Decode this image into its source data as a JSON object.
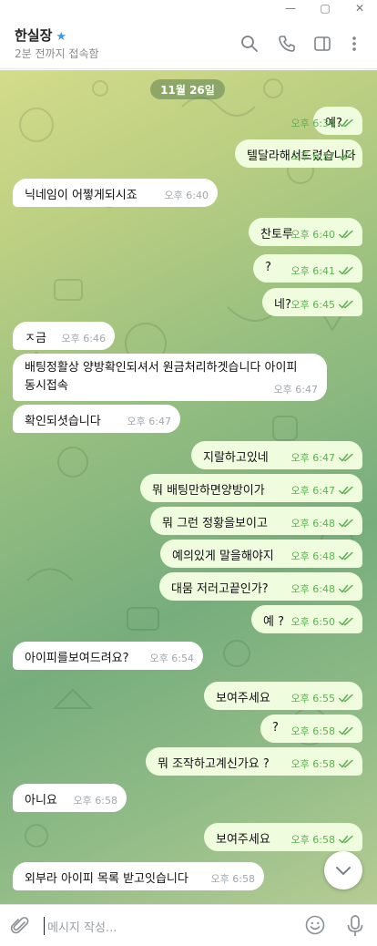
{
  "window": {
    "controls": [
      "—",
      "▢",
      "✕"
    ]
  },
  "header": {
    "name": "한실장",
    "star": "★",
    "status": "2분 전까지 접속함",
    "icons": [
      "search-icon",
      "phone-icon",
      "sidebar-toggle-icon",
      "more-vertical-icon"
    ]
  },
  "chat": {
    "date": "11월 26일",
    "messages": [
      {
        "dir": "out",
        "text": "예?",
        "time": "오후 6:34"
      },
      {
        "dir": "out",
        "text": "텔달라해서드렸습니다",
        "time": "오후 6:37"
      },
      {
        "dir": "in",
        "text": "닉네임이 어쩧게되시죠",
        "time": "오후 6:40"
      },
      {
        "dir": "out",
        "text": "찬토루",
        "time": "오후 6:40"
      },
      {
        "dir": "out",
        "text": "?",
        "time": "오후 6:41"
      },
      {
        "dir": "out",
        "text": "네?",
        "time": "오후 6:45"
      },
      {
        "dir": "in",
        "text": "ㅈ금",
        "time": "오후 6:46"
      },
      {
        "dir": "in",
        "text": "배팅정활상 양방확인되셔서 원금처리하겟습니다 아이피 동시접속",
        "time": "오후 6:47"
      },
      {
        "dir": "in",
        "text": "확인되셧습니다",
        "time": "오후 6:47"
      },
      {
        "dir": "out",
        "text": "지랄하고있네",
        "time": "오후 6:47"
      },
      {
        "dir": "out",
        "text": "뭐 배팅만하면양방이가",
        "time": "오후 6:47"
      },
      {
        "dir": "out",
        "text": "뭐 그런 정황을보이고",
        "time": "오후 6:48"
      },
      {
        "dir": "out",
        "text": "예의있게 말을해야지",
        "time": "오후 6:48"
      },
      {
        "dir": "out",
        "text": "대뭄 저러고끝인가?",
        "time": "오후 6:48"
      },
      {
        "dir": "out",
        "text": "예 ?",
        "time": "오후 6:50"
      },
      {
        "dir": "in",
        "text": "아이피를보여드려요?",
        "time": "오후 6:54"
      },
      {
        "dir": "out",
        "text": "보여주세요",
        "time": "오후 6:55"
      },
      {
        "dir": "out",
        "text": "?",
        "time": "오후 6:58"
      },
      {
        "dir": "out",
        "text": "뭐 조작하고계신가요 ?",
        "time": "오후 6:58"
      },
      {
        "dir": "in",
        "text": "아니요",
        "time": "오후 6:58"
      },
      {
        "dir": "out",
        "text": "보여주세요",
        "time": "오후 6:58"
      },
      {
        "dir": "in",
        "text": "외부라 아이피 목록 받고잇습니다",
        "time": "오후 6:58"
      }
    ]
  },
  "composer": {
    "placeholder": "메시지 작성..."
  },
  "colors": {
    "outgoing_bubble": "#effdde",
    "incoming_bubble": "#ffffff",
    "check_green": "#5fae55",
    "accent_blue": "#3f9ae6"
  }
}
